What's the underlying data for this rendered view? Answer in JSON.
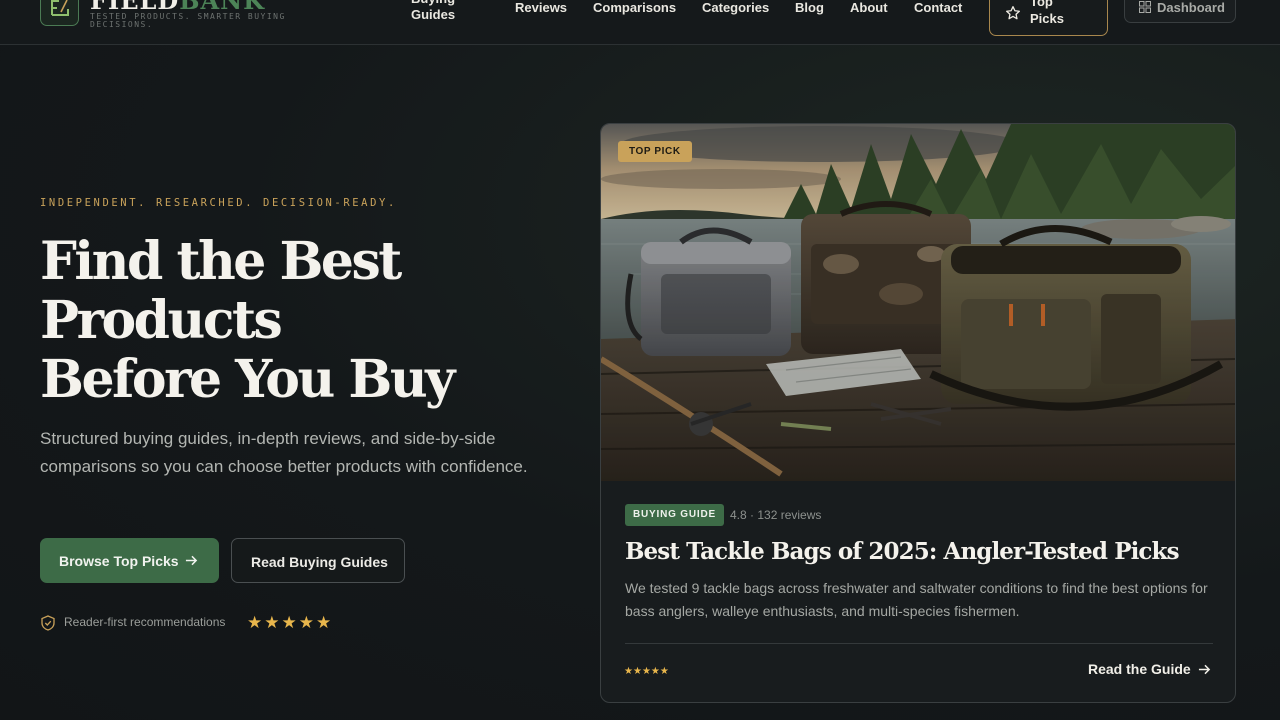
{
  "header": {
    "brand": {
      "name_part1": "FIELD",
      "name_part2": "BANK",
      "tagline": "Tested products. Smarter buying decisions."
    },
    "nav": [
      {
        "label": "Buying Guides"
      },
      {
        "label": "Reviews"
      },
      {
        "label": "Comparisons"
      },
      {
        "label": "Categories"
      },
      {
        "label": "Blog"
      },
      {
        "label": "About"
      },
      {
        "label": "Contact"
      }
    ],
    "top_picks_label": "Top Picks",
    "dashboard_label": "Dashboard"
  },
  "hero": {
    "eyebrow": "INDEPENDENT. RESEARCHED. DECISION-READY.",
    "title_line1": "Find the Best",
    "title_line2": "Products",
    "title_line3": "Before You Buy",
    "subtitle": "Structured buying guides, in-depth reviews, and side-by-side comparisons so you can choose better products with confidence.",
    "primary_cta": "Browse Top Picks",
    "secondary_cta": "Read Buying Guides",
    "trust_text": "Reader-first recommendations",
    "trust_stars": 5
  },
  "featured_card": {
    "badge": "TOP PICK",
    "category_badge": "BUYING GUIDE",
    "rating_meta": "4.8 · 132 reviews",
    "title": "Best Tackle Bags of 2025: Angler-Tested Picks",
    "description": "We tested 9 tackle bags across freshwater and saltwater conditions to find the best options for bass anglers, walleye enthusiasts, and multi-species fishermen.",
    "stars": 5,
    "cta": "Read the Guide"
  },
  "colors": {
    "accent_green": "#3d6b47",
    "accent_gold": "#c9a25a",
    "star_color": "#e8b64c",
    "background": "#14181a"
  },
  "icons": [
    "logo-icon",
    "star-outline-icon",
    "grid-icon",
    "arrow-right-icon",
    "shield-check-icon",
    "star-icon"
  ]
}
